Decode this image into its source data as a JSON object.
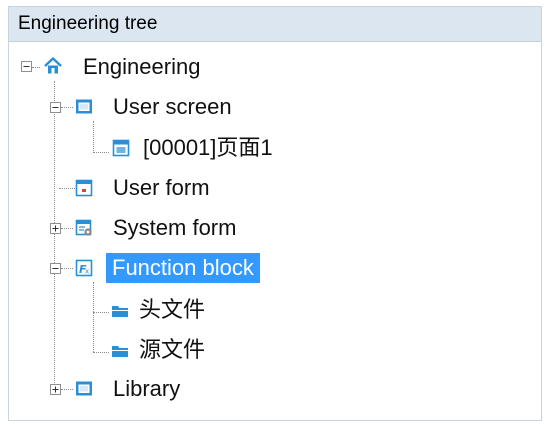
{
  "panel": {
    "title": "Engineering tree"
  },
  "tree": {
    "root": {
      "label": "Engineering",
      "icon": "home-icon",
      "expanded": true
    },
    "user_screen": {
      "label": "User screen",
      "icon": "screen-icon",
      "expanded": true
    },
    "page1": {
      "label": "[00001]页面1",
      "icon": "page-icon"
    },
    "user_form": {
      "label": "User form",
      "icon": "form-icon"
    },
    "system_form": {
      "label": "System form",
      "icon": "system-form-icon",
      "expanded": false
    },
    "function_block": {
      "label": "Function block",
      "icon": "function-block-icon",
      "expanded": true,
      "selected": true
    },
    "header_files": {
      "label": "头文件",
      "icon": "folder-icon"
    },
    "source_files": {
      "label": "源文件",
      "icon": "folder-icon"
    },
    "library": {
      "label": "Library",
      "icon": "library-icon",
      "expanded": false
    }
  },
  "colors": {
    "selection": "#3399ff",
    "header_bg": "#dbe6f1",
    "icon_blue": "#2b8fd6",
    "icon_red": "#e04040"
  }
}
